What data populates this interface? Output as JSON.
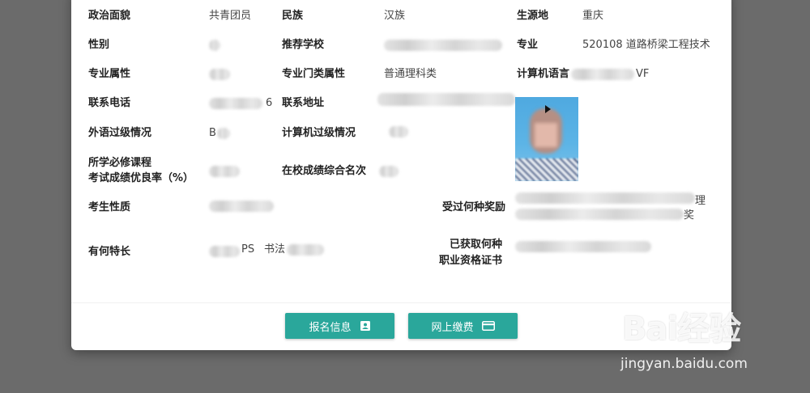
{
  "profile": {
    "political_status": {
      "label": "政治面貌",
      "value": "共青团员"
    },
    "ethnicity": {
      "label": "民族",
      "value": "汉族"
    },
    "origin": {
      "label": "生源地",
      "value": "重庆"
    },
    "gender": {
      "label": "性别"
    },
    "recommend_school": {
      "label": "推荐学校"
    },
    "major": {
      "label": "专业",
      "value": "520108 道路桥梁工程技术"
    },
    "major_attribute": {
      "label": "专业属性"
    },
    "major_category": {
      "label": "专业门类属性",
      "value": "普通理科类"
    },
    "computer_language": {
      "label": "计算机语言",
      "value_tail": "VF"
    },
    "phone": {
      "label": "联系电话",
      "value_tail": "6"
    },
    "address": {
      "label": "联系地址"
    },
    "foreign_lang": {
      "label": "外语过级情况",
      "value_head": "B"
    },
    "computer_level": {
      "label": "计算机过级情况"
    },
    "course_rate": {
      "label_line1": "所学必修课程",
      "label_line2": "考试成绩优良率（%）"
    },
    "rank": {
      "label": "在校成绩综合名次"
    },
    "candidate_type": {
      "label": "考生性质"
    },
    "awards": {
      "label": "受过何种奖励",
      "tail1": "理",
      "tail2": "奖"
    },
    "specialty": {
      "label": "有何特长",
      "mid": "PS",
      "mid2": "书法"
    },
    "certificates": {
      "label_line1": "已获取何种",
      "label_line2": "职业资格证书"
    }
  },
  "buttons": {
    "signup_info": {
      "label": "报名信息",
      "icon": "id-card-icon"
    },
    "pay_online": {
      "label": "网上缴费",
      "icon": "credit-card-icon"
    }
  },
  "watermark": {
    "logo": "Bai经验",
    "url": "jingyan.baidu.com"
  },
  "colors": {
    "accent": "#2aa79b",
    "overlay": "#6b6b6b"
  }
}
